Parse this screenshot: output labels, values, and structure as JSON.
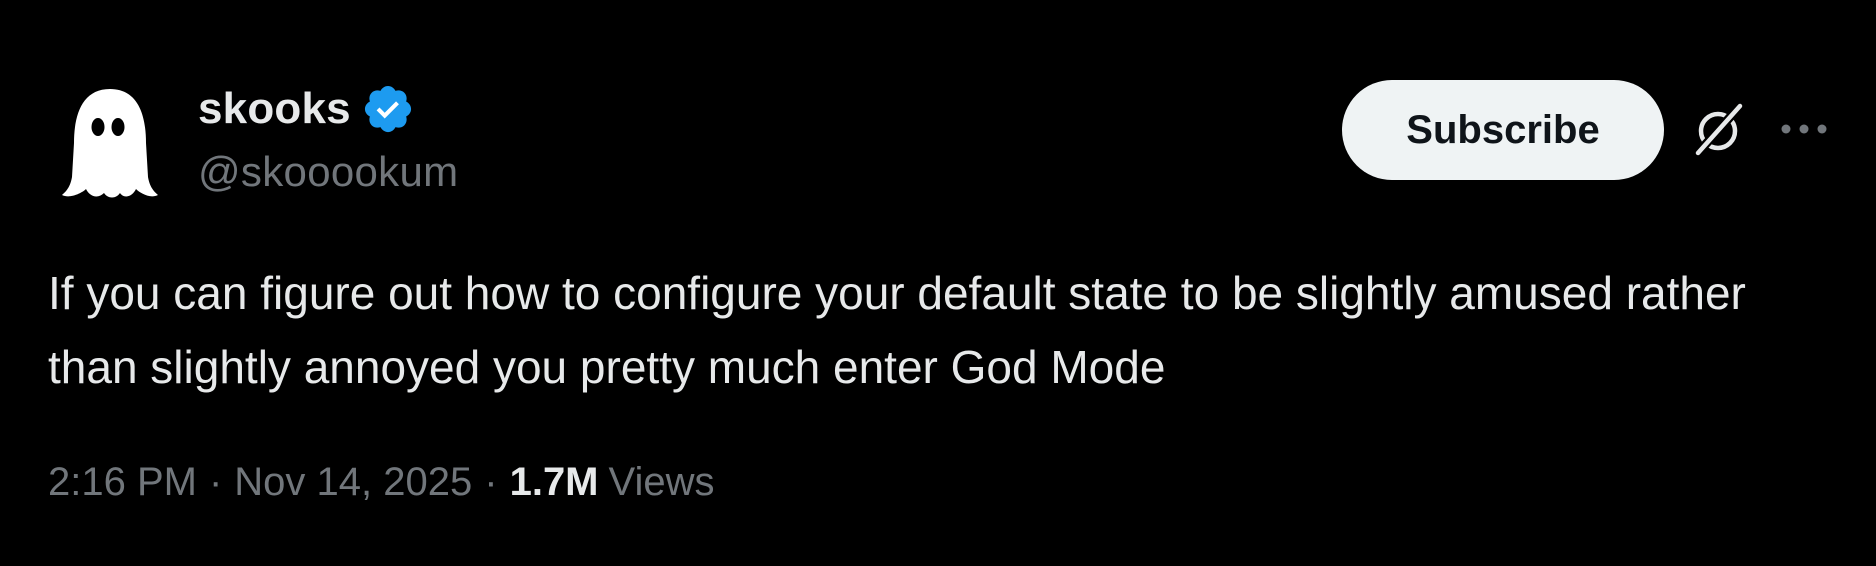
{
  "author": {
    "display_name": "skooks",
    "handle": "@skooookum",
    "verified": true,
    "avatar_icon": "ghost-icon",
    "verified_color": "#1d9bf0"
  },
  "actions": {
    "subscribe_label": "Subscribe",
    "grok_icon": "grok-icon",
    "more_icon": "more-horizontal-icon"
  },
  "tweet": {
    "text": "If you can figure out how to configure your default state to be slightly amused rather than slightly annoyed you pretty much enter God Mode",
    "time": "2:16 PM",
    "separator": "·",
    "date": "Nov 14, 2025",
    "views_count": "1.7M",
    "views_label": "Views"
  },
  "colors": {
    "background": "#000000",
    "primary_text": "#e7e9ea",
    "secondary_text": "#71767b",
    "button_bg": "#eff3f4",
    "button_text": "#0f1419"
  }
}
